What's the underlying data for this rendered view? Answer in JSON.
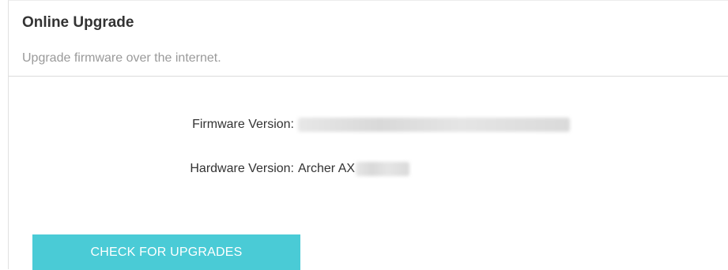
{
  "section": {
    "title": "Online Upgrade",
    "subtitle": "Upgrade firmware over the internet."
  },
  "firmware": {
    "label": "Firmware Version:",
    "value_redacted": true
  },
  "hardware": {
    "label": "Hardware Version:",
    "value": "Archer AX",
    "suffix_redacted": true
  },
  "actions": {
    "check_label": "CHECK FOR UPGRADES"
  },
  "colors": {
    "accent": "#4acbd6",
    "text": "#333333",
    "muted": "#9a9a9a"
  }
}
